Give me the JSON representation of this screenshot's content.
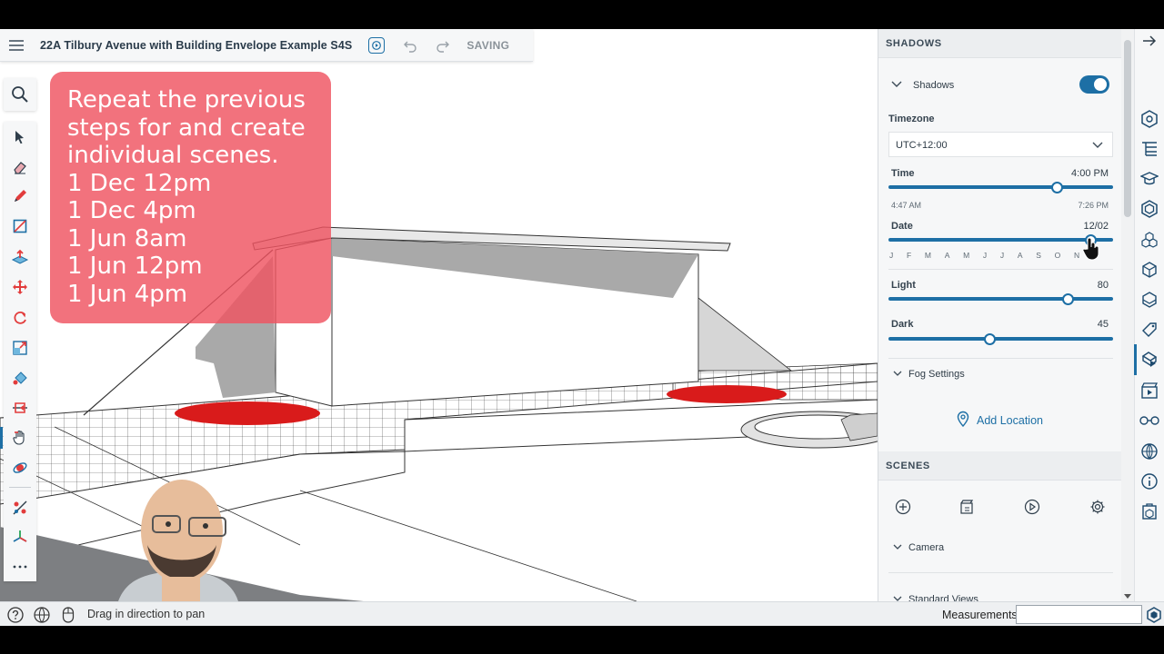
{
  "titlebar": {
    "title": "22A Tilbury Avenue with Building Envelope Example S4S",
    "status": "SAVING"
  },
  "note": {
    "lines": [
      "Repeat the previous",
      "steps for and create",
      "individual scenes.",
      "1 Dec 12pm",
      "1 Dec 4pm",
      "1 Jun 8am",
      "1 Jun 12pm",
      "1 Jun 4pm"
    ],
    "color": "#ef5360"
  },
  "toolbar": {
    "tools": [
      "select-icon",
      "eraser-icon",
      "pencil-icon",
      "rectangle-icon",
      "push-pull-icon",
      "move-icon",
      "rotate-icon",
      "scale-icon",
      "paint-bucket-icon",
      "section-plane-icon",
      "pan-hand-icon",
      "orbit-icon",
      "tape-measure-icon",
      "axes-icon",
      "more-icon"
    ],
    "active_tool": "pan-hand-icon"
  },
  "statusbar": {
    "hint": "Drag in direction to pan",
    "measurements_label": "Measurements",
    "measurements_value": ""
  },
  "panel": {
    "header": "SHADOWS",
    "shadows_label": "Shadows",
    "shadows_on": true,
    "timezone_label": "Timezone",
    "timezone_value": "UTC+12:00",
    "time_label": "Time",
    "time_value": "4:00 PM",
    "time_min": "4:47 AM",
    "time_max": "7:26 PM",
    "time_fraction": 0.75,
    "date_label": "Date",
    "date_value": "12/02",
    "date_fraction": 0.9,
    "months": [
      "J",
      "F",
      "M",
      "A",
      "M",
      "J",
      "J",
      "A",
      "S",
      "O",
      "N",
      "D"
    ],
    "light_label": "Light",
    "light_value": "80",
    "dark_label": "Dark",
    "dark_value": "45",
    "fog_label": "Fog Settings",
    "add_location": "Add Location",
    "scenes_header": "SCENES",
    "camera_label": "Camera",
    "standard_views_label": "Standard Views"
  },
  "colors": {
    "accent": "#1d6fa5",
    "shadow_marker": "#d91b1b"
  }
}
